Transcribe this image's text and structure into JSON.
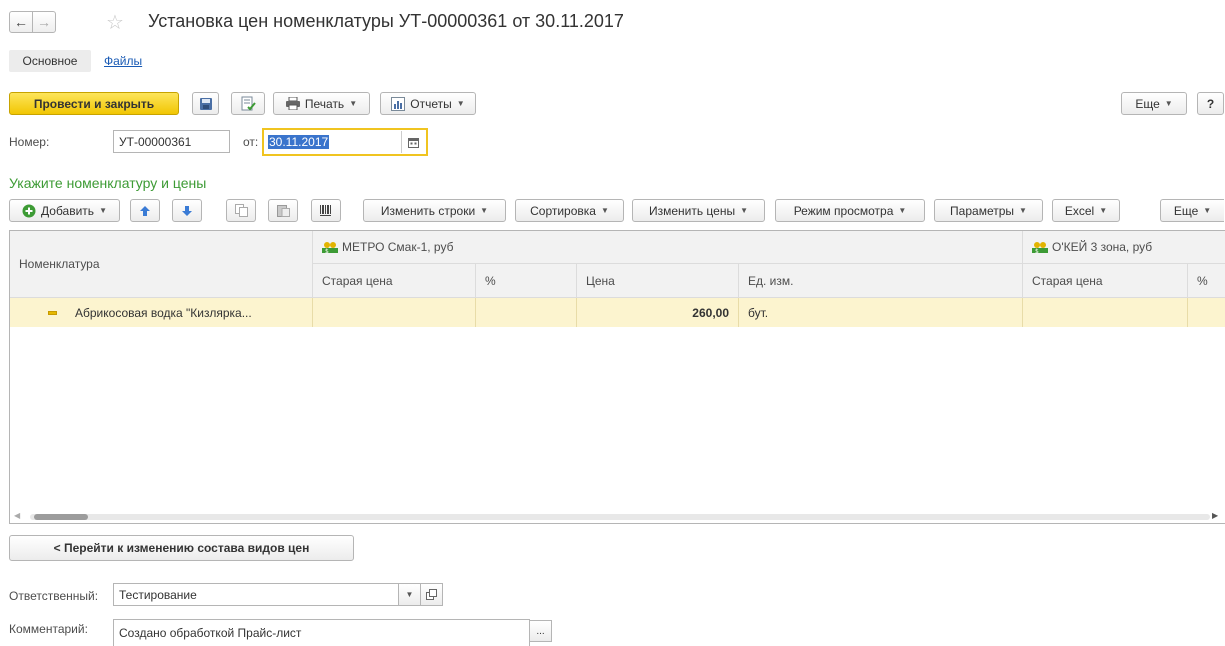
{
  "title": "Установка цен номенклатуры УТ-00000361 от 30.11.2017",
  "tabs": {
    "main": "Основное",
    "files": "Файлы"
  },
  "toolbar": {
    "post_close": "Провести и закрыть",
    "print": "Печать",
    "reports": "Отчеты",
    "more": "Еще",
    "help": "?"
  },
  "header": {
    "number_label": "Номер:",
    "number_value": "УТ-00000361",
    "date_label": "от:",
    "date_value": "30.11.2017"
  },
  "section_title": "Укажите номенклатуру и цены",
  "table_toolbar": {
    "add": "Добавить",
    "change_rows": "Изменить строки",
    "sort": "Сортировка",
    "change_prices": "Изменить цены",
    "view_mode": "Режим просмотра",
    "params": "Параметры",
    "excel": "Excel",
    "more": "Еще"
  },
  "table": {
    "col_nomenclature": "Номенклатура",
    "price_groups": [
      "МЕТРО Смак-1, руб",
      "О'КЕЙ 3 зона, руб"
    ],
    "sub_headers": [
      "Старая цена",
      "%",
      "Цена",
      "Ед. изм.",
      "Старая цена",
      "%"
    ],
    "rows": [
      {
        "name": "Абрикосовая водка \"Кизлярка...",
        "old_price": "",
        "percent": "",
        "price": "260,00",
        "unit": "бут.",
        "old_price2": "",
        "percent2": ""
      }
    ]
  },
  "bottom": {
    "goto_button": "< Перейти к изменению состава видов цен",
    "responsible_label": "Ответственный:",
    "responsible_value": "Тестирование",
    "comment_label": "Комментарий:",
    "comment_value": "Создано обработкой Прайс-лист",
    "ellipsis": "..."
  },
  "colors": {
    "accent_yellow": "#f5d000",
    "selected_row": "#fcf4cf",
    "section_green": "#3d9b35",
    "focus_border": "#f0c420",
    "selection_blue": "#3a74cc"
  },
  "icons": [
    "back-arrow-icon",
    "forward-arrow-icon",
    "star-icon",
    "save-icon",
    "post-icon",
    "printer-icon",
    "reports-icon",
    "calendar-icon",
    "add-icon",
    "move-up-icon",
    "move-down-icon",
    "copy-icon",
    "paste-icon",
    "barcode-icon",
    "price-type-icon",
    "row-marker-icon",
    "dropdown-icon",
    "open-icon"
  ]
}
